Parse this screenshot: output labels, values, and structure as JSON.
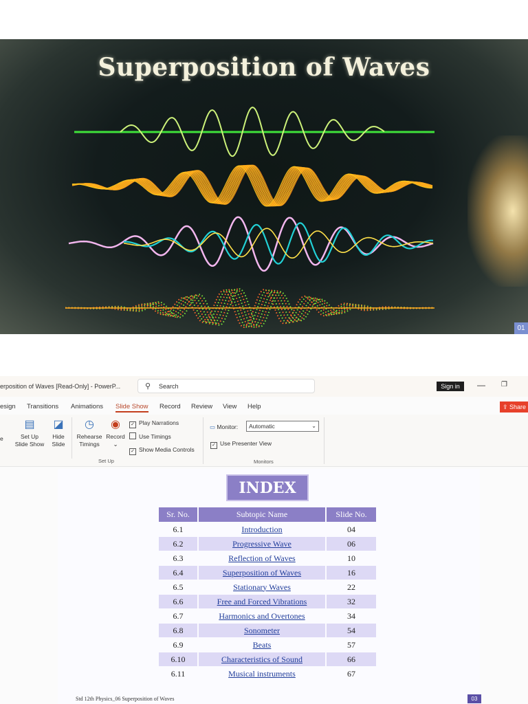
{
  "slide_top": {
    "title": "Superposition of Waves",
    "slide_number": "01"
  },
  "window": {
    "title": "erposition of Waves [Read-Only] - PowerP...",
    "search_placeholder": "Search",
    "sign_in": "Sign in",
    "minimize": "—",
    "restore": "❐"
  },
  "tabs": [
    {
      "label": "esign"
    },
    {
      "label": "Transitions"
    },
    {
      "label": "Animations"
    },
    {
      "label": "Slide Show"
    },
    {
      "label": "Record"
    },
    {
      "label": "Review"
    },
    {
      "label": "View"
    },
    {
      "label": "Help"
    }
  ],
  "share_label": "Share",
  "ribbon": {
    "partial_left": "e",
    "setup_slideshow_1": "Set Up",
    "setup_slideshow_2": "Slide Show",
    "hide_slide_1": "Hide",
    "hide_slide_2": "Slide",
    "rehearse_1": "Rehearse",
    "rehearse_2": "Timings",
    "record": "Record",
    "record_chevron": "⌄",
    "play_narrations": "Play Narrations",
    "use_timings": "Use Timings",
    "show_media_controls": "Show Media Controls",
    "setup_group": "Set Up",
    "monitor_label": "Monitor:",
    "monitor_value": "Automatic",
    "use_presenter_view": "Use Presenter View",
    "monitors_group": "Monitors",
    "checks": {
      "play_narrations": true,
      "use_timings": false,
      "show_media_controls": true,
      "use_presenter_view": true
    }
  },
  "index_slide": {
    "title": "INDEX",
    "headers": [
      "Sr. No.",
      "Subtopic Name",
      "Slide No."
    ],
    "rows": [
      {
        "sr": "6.1",
        "name": "Introduction",
        "slide": "04"
      },
      {
        "sr": "6.2",
        "name": "Progressive Wave",
        "slide": "06"
      },
      {
        "sr": "6.3",
        "name": "Reflection of Waves",
        "slide": "10"
      },
      {
        "sr": "6.4",
        "name": "Superposition of Waves",
        "slide": "16"
      },
      {
        "sr": "6.5",
        "name": "Stationary Waves",
        "slide": "22"
      },
      {
        "sr": "6.6",
        "name": "Free and Forced Vibrations",
        "slide": "32"
      },
      {
        "sr": "6.7",
        "name": "Harmonics and Overtones",
        "slide": "34"
      },
      {
        "sr": "6.8",
        "name": "Sonometer",
        "slide": "54"
      },
      {
        "sr": "6.9",
        "name": "Beats",
        "slide": "57"
      },
      {
        "sr": "6.10",
        "name": "Characteristics of Sound",
        "slide": "66"
      },
      {
        "sr": "6.11",
        "name": "Musical instruments",
        "slide": "67"
      }
    ],
    "footer": "Std 12th Physics_06 Superposition of Waves",
    "slide_number": "03"
  },
  "colors": {
    "accent": "#c43e1c",
    "table_header": "#8b7fc6",
    "table_shade": "#ddd9f5",
    "link": "#1f3c9a"
  }
}
